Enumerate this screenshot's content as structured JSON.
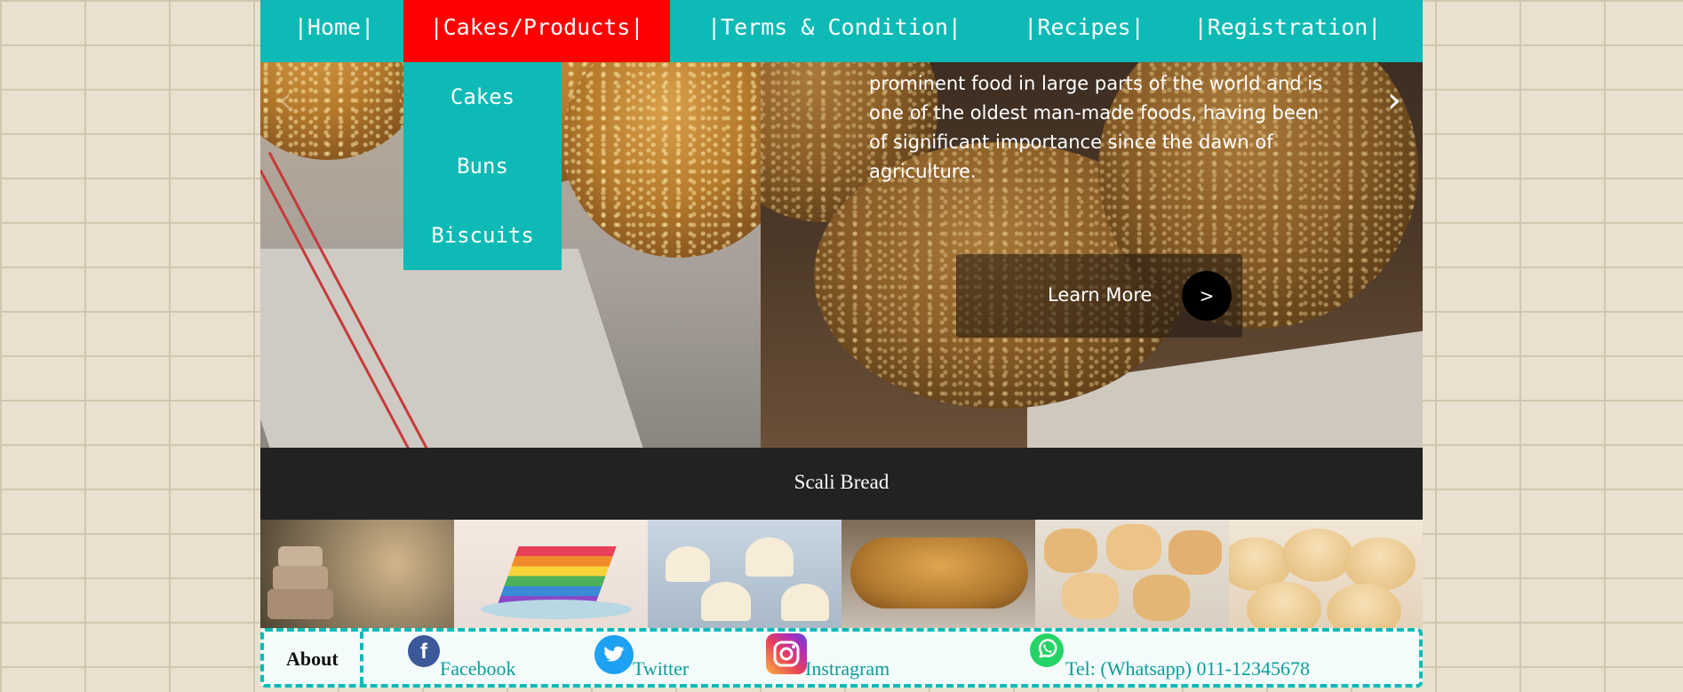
{
  "nav": {
    "items": [
      {
        "label": "|Home|"
      },
      {
        "label": "|Cakes/Products|"
      },
      {
        "label": "|Terms & Condition|"
      },
      {
        "label": "|Recipes|"
      },
      {
        "label": "|Registration|"
      }
    ],
    "active_color": "#ff0000",
    "bar_color": "#0dbab5"
  },
  "dropdown": {
    "items": [
      {
        "label": "Cakes"
      },
      {
        "label": "Buns"
      },
      {
        "label": "Biscuits"
      }
    ]
  },
  "hero": {
    "text_lines": [
      "prominent food in large parts of the world and is",
      "one of the oldest man-made foods, having been",
      "of significant importance since the dawn of",
      "agriculture."
    ],
    "learn_more": "Learn More",
    "learn_more_arrow": ">",
    "prev_arrow": "‹",
    "next_arrow": "›"
  },
  "caption": {
    "title": "Scali Bread"
  },
  "thumbnails": [
    {
      "icon": "tiered-cake-image"
    },
    {
      "icon": "rainbow-cake-image"
    },
    {
      "icon": "cupcakes-image"
    },
    {
      "icon": "braided-bread-image"
    },
    {
      "icon": "biscuits-image"
    },
    {
      "icon": "buns-image"
    }
  ],
  "footer": {
    "about": "About",
    "facebook": "Facebook",
    "twitter": "Twitter",
    "instagram": "Instragram",
    "whatsapp": "Tel: (Whatsapp) 011-12345678"
  }
}
